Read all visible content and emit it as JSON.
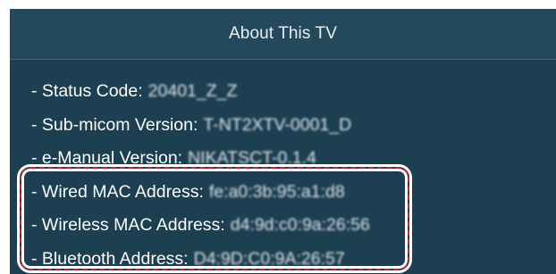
{
  "dialog": {
    "title": "About This TV"
  },
  "info_rows": [
    {
      "label": "- Status Code:",
      "value": "20401_Z_Z"
    },
    {
      "label": "- Sub-micom Version:",
      "value": "T-NT2XTV-0001_D"
    },
    {
      "label": "- e-Manual Version:",
      "value": "NIKATSCT-0.1.4"
    },
    {
      "label": "- Wired MAC Address:",
      "value": "fe:a0:3b:95:a1:d8"
    },
    {
      "label": "- Wireless MAC Address:",
      "value": "d4:9d:c0:9a:26:56"
    },
    {
      "label": "- Bluetooth Address:",
      "value": "D4:9D:C0:9A:26:57"
    }
  ],
  "colors": {
    "panel_background": "#1c3f51",
    "header_background": "#24495c",
    "highlight_border": "#d61f2b"
  }
}
